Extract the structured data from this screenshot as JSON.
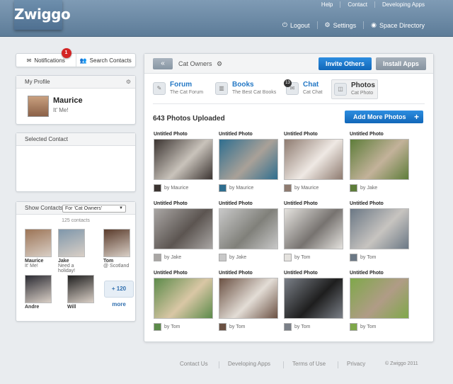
{
  "app": {
    "logo": "Zwiggo"
  },
  "topnav": [
    "Help",
    "Contact",
    "Developing Apps"
  ],
  "subnav": [
    {
      "icon": "power-icon",
      "glyph": "⏻",
      "label": "Logout"
    },
    {
      "icon": "gear-icon",
      "glyph": "⚙",
      "label": "Settings"
    },
    {
      "icon": "globe-icon",
      "glyph": "◉",
      "label": "Space Directory"
    }
  ],
  "left": {
    "tabs": {
      "notifications": "Notifications",
      "notifications_count": "1",
      "search": "Search Contacts"
    },
    "profile": {
      "header": "My Profile",
      "name": "Maurice",
      "status": "It' Me!"
    },
    "selected_contact": {
      "header": "Selected Contact"
    },
    "show_contacts": {
      "header": "Show Contacts",
      "filter": "For 'Cat Owners'",
      "count": "125 contacts",
      "contacts": [
        {
          "name": "Maurice",
          "status": "It' Me!",
          "color": "#9c7456"
        },
        {
          "name": "Jake",
          "status": "Need a holiday!",
          "color": "#7f97ab"
        },
        {
          "name": "Tom",
          "status": "@ Scotland",
          "color": "#5a3b2b"
        },
        {
          "name": "Andre",
          "status": "",
          "color": "#2b2b33"
        },
        {
          "name": "Will",
          "status": "",
          "color": "#1f1f1f"
        }
      ],
      "more": "+ 120 more"
    }
  },
  "main": {
    "back": "«",
    "breadcrumb": "Cat Owners",
    "invite": "Invite Others",
    "install": "Install Apps",
    "apps": [
      {
        "icon": "forum-icon",
        "glyph": "✎",
        "title": "Forum",
        "sub": "The Cat Forum"
      },
      {
        "icon": "books-icon",
        "glyph": "▥",
        "title": "Books",
        "sub": "The Best Cat Books"
      },
      {
        "icon": "chat-icon",
        "glyph": "✉",
        "title": "Chat",
        "sub": "Cat Chat",
        "badge": "13"
      },
      {
        "icon": "photos-icon",
        "glyph": "◫",
        "title": "Photos",
        "sub": "Cat Photo"
      }
    ],
    "uploaded": "643 Photos Uploaded",
    "add_more": "Add More Photos",
    "photos": [
      {
        "title": "Untitled Photo",
        "by": "by Maurice",
        "c1": "#3b3431",
        "c2": "#c9c3bb"
      },
      {
        "title": "Untitled Photo",
        "by": "by Maurice",
        "c1": "#2f6e8f",
        "c2": "#a9a198"
      },
      {
        "title": "Untitled Photo",
        "by": "by Maurice",
        "c1": "#8e7b70",
        "c2": "#efe9e4"
      },
      {
        "title": "Untitled Photo",
        "by": "by Jake",
        "c1": "#5e7d3a",
        "c2": "#c3b29a"
      },
      {
        "title": "Untitled Photo",
        "by": "by Jake",
        "c1": "#a9a6a4",
        "c2": "#5c5551"
      },
      {
        "title": "Untitled Photo",
        "by": "by Jake",
        "c1": "#c8c8c8",
        "c2": "#80807a"
      },
      {
        "title": "Untitled Photo",
        "by": "by Tom",
        "c1": "#e4e2de",
        "c2": "#777370"
      },
      {
        "title": "Untitled Photo",
        "by": "by Tom",
        "c1": "#6b7885",
        "c2": "#c7c4c0"
      },
      {
        "title": "Untitled Photo",
        "by": "by Tom",
        "c1": "#5c8a4a",
        "c2": "#d9c7a5"
      },
      {
        "title": "Untitled Photo",
        "by": "by Tom",
        "c1": "#6b5143",
        "c2": "#e3ddd6"
      },
      {
        "title": "Untitled Photo",
        "by": "by Tom",
        "c1": "#7a7f87",
        "c2": "#1e1e1e"
      },
      {
        "title": "Untitled Photo",
        "by": "by Tom",
        "c1": "#7fa84a",
        "c2": "#b09c86"
      }
    ]
  },
  "footer": {
    "links": [
      "Contact Us",
      "Developing Apps",
      "Terms of Use",
      "Privacy"
    ],
    "copyright": "© Zwiggo 2011"
  }
}
